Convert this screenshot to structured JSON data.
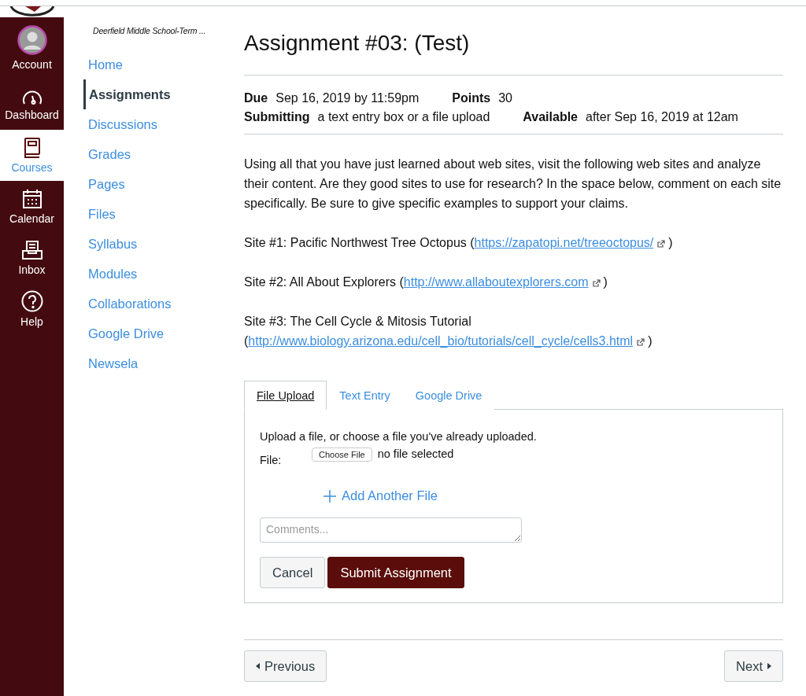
{
  "global_nav": [
    {
      "kind": "account",
      "label": "Account",
      "selected": false
    },
    {
      "kind": "dashboard",
      "label": "Dashboard",
      "selected": false
    },
    {
      "kind": "courses",
      "label": "Courses",
      "selected": true
    },
    {
      "kind": "calendar",
      "label": "Calendar",
      "selected": false
    },
    {
      "kind": "inbox",
      "label": "Inbox",
      "selected": false
    },
    {
      "kind": "help",
      "label": "Help",
      "selected": false
    }
  ],
  "course_nav": {
    "course_title": "Deerfield Middle School-Term ...",
    "items": [
      {
        "label": "Home",
        "selected": false
      },
      {
        "label": "Assignments",
        "selected": true
      },
      {
        "label": "Discussions",
        "selected": false
      },
      {
        "label": "Grades",
        "selected": false
      },
      {
        "label": "Pages",
        "selected": false
      },
      {
        "label": "Files",
        "selected": false
      },
      {
        "label": "Syllabus",
        "selected": false
      },
      {
        "label": "Modules",
        "selected": false
      },
      {
        "label": "Collaborations",
        "selected": false
      },
      {
        "label": "Google Drive",
        "selected": false
      },
      {
        "label": "Newsela",
        "selected": false
      }
    ]
  },
  "assignment": {
    "title": "Assignment #03: (Test)",
    "details": [
      [
        {
          "label": "Due",
          "value": "Sep 16, 2019 by 11:59pm"
        },
        {
          "label": "Points",
          "value": "30"
        }
      ],
      [
        {
          "label": "Submitting",
          "value": "a text entry box or a file upload"
        },
        {
          "label": "Available",
          "value": "after Sep 16, 2019 at 12am"
        }
      ]
    ],
    "description": "Using all that you have just learned about web sites, visit the following web sites and analyze their content. Are they good sites to use for research? In the space below, comment on each site specifically. Be sure to give specific examples to support your claims.",
    "sites": [
      {
        "prefix": "Site #1: Pacific Northwest Tree Octopus (",
        "url": "https://zapatopi.net/treeoctopus/",
        "suffix": ")"
      },
      {
        "prefix": "Site #2: All About Explorers (",
        "url": "http://www.allaboutexplorers.com",
        "suffix": ")"
      },
      {
        "prefix": "Site #3: The Cell Cycle & Mitosis Tutorial",
        "second_line_prefix": "(",
        "url": "http://www.biology.arizona.edu/cell_bio/tutorials/cell_cycle/cells3.html",
        "suffix": ")"
      }
    ]
  },
  "submission": {
    "tabs": [
      {
        "label": "File Upload",
        "selected": true
      },
      {
        "label": "Text Entry",
        "selected": false
      },
      {
        "label": "Google Drive",
        "selected": false
      }
    ],
    "instructions": "Upload a file, or choose a file you've already uploaded.",
    "file_label": "File:",
    "choose_button": "Choose File",
    "file_status": "no file selected",
    "add_file": "Add Another File",
    "comments_placeholder": "Comments...",
    "cancel": "Cancel",
    "submit": "Submit Assignment"
  },
  "footer": {
    "previous": "Previous",
    "next": "Next"
  }
}
